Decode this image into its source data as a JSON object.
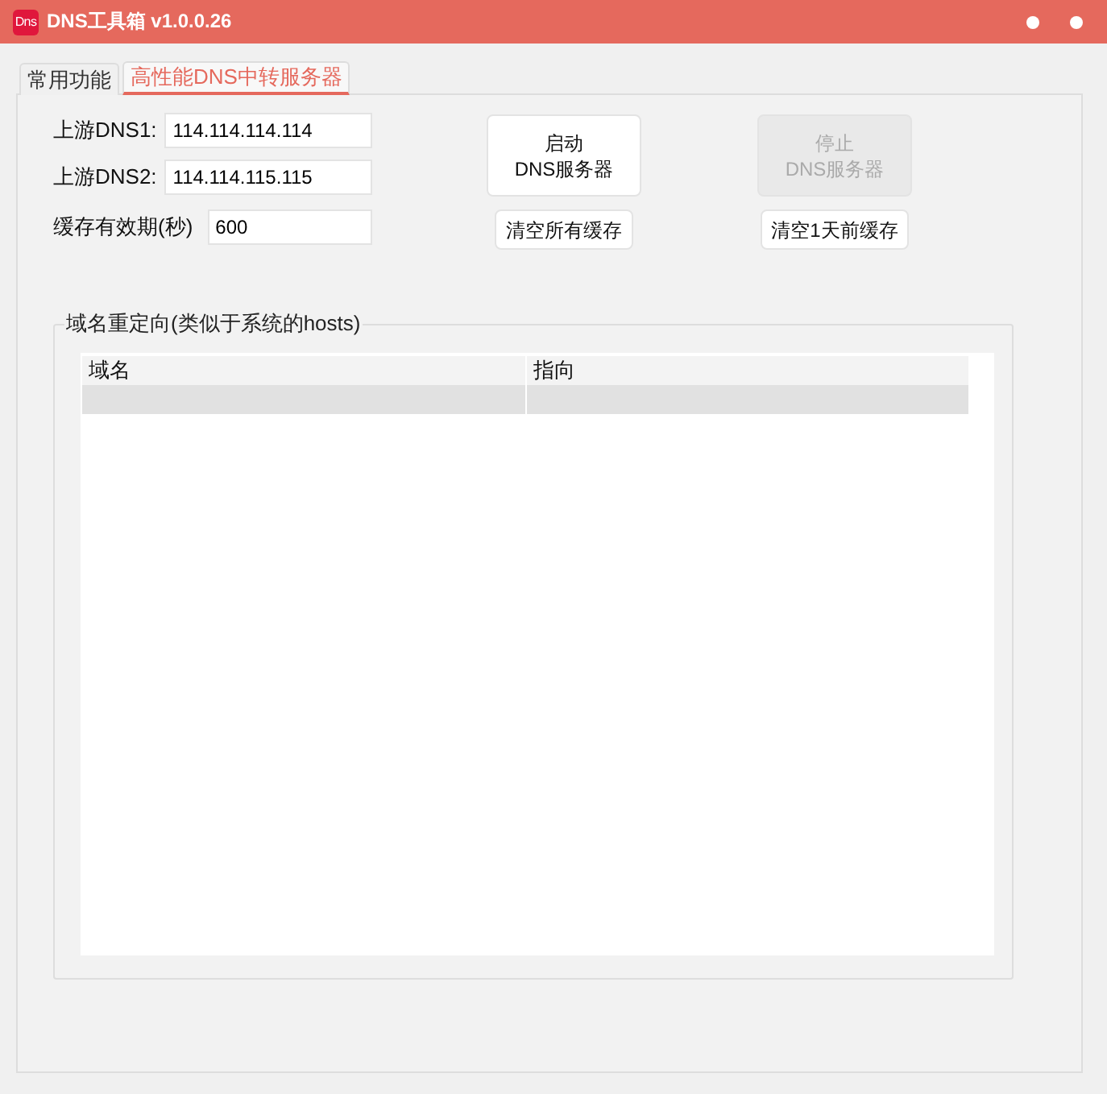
{
  "window": {
    "app_icon": "Dns",
    "title": "DNS工具箱 v1.0.0.26"
  },
  "tabs": [
    {
      "label": "常用功能",
      "selected": false
    },
    {
      "label": "高性能DNS中转服务器",
      "selected": true
    }
  ],
  "settings": [
    {
      "label": "上游DNS1:",
      "value": "114.114.114.114"
    },
    {
      "label": "上游DNS2:",
      "value": "114.114.115.115"
    },
    {
      "label": "缓存有效期(秒)",
      "value": "600"
    }
  ],
  "buttons": [
    {
      "label": "启动\nDNS服务器",
      "kind": "large",
      "disabled": false
    },
    {
      "label": "停止\nDNS服务器",
      "kind": "large",
      "disabled": true
    },
    {
      "label": "清空所有缓存",
      "kind": "small",
      "disabled": false
    },
    {
      "label": "清空1天前缓存",
      "kind": "small",
      "disabled": false
    }
  ],
  "redirect_group": {
    "title": "域名重定向(类似于系统的hosts)",
    "table": {
      "columns": [
        "域名",
        "指向"
      ],
      "rows": [
        {
          "selected": true
        }
      ]
    }
  }
}
